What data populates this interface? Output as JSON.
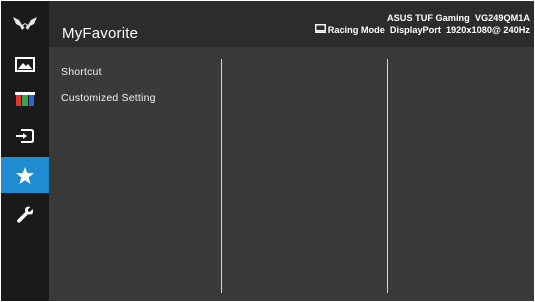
{
  "osd": {
    "title": "MyFavorite",
    "model": "ASUS TUF Gaming  VG249QM1A",
    "mode": "Racing Mode",
    "input": "DisplayPort",
    "resolution": "1920x1080@ 240Hz"
  },
  "sidebar": {
    "items": [
      {
        "icon": "tuf-logo-icon"
      },
      {
        "icon": "image-icon"
      },
      {
        "icon": "color-icon"
      },
      {
        "icon": "input-select-icon"
      },
      {
        "icon": "star-icon",
        "active": true
      },
      {
        "icon": "wrench-icon"
      }
    ]
  },
  "menu": {
    "items": [
      {
        "label": "Shortcut"
      },
      {
        "label": "Customized Setting"
      }
    ]
  },
  "colors": {
    "active_accent": "#1f8bd0",
    "header_bg": "#2c2c2c",
    "content_bg": "#3a3a3a",
    "sidebar_bg": "#1a1a1a"
  }
}
